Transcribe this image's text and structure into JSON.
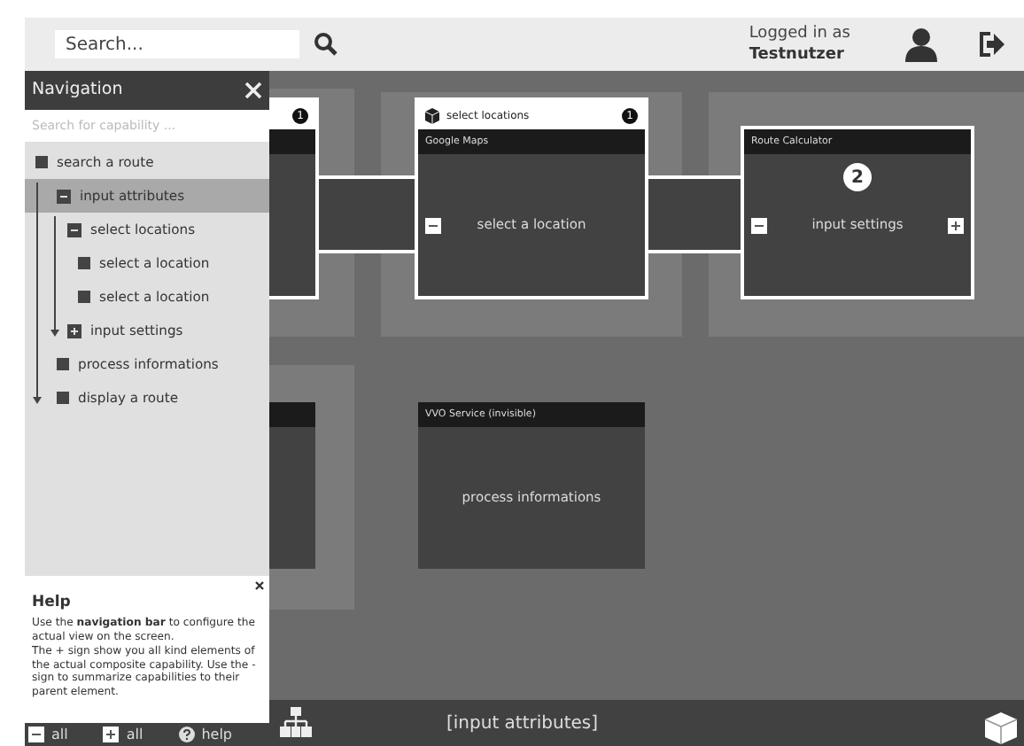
{
  "header": {
    "search_placeholder": "Search...",
    "login_label": "Logged in as",
    "username": "Testnutzer"
  },
  "navigation": {
    "title": "Navigation",
    "search_placeholder": "Search for capability ...",
    "tree": [
      {
        "label": "search a route",
        "selected": false,
        "children": [
          {
            "label": "input attributes",
            "selected": true,
            "expanded": true,
            "children": [
              {
                "label": "select locations",
                "selected": false,
                "expanded": true,
                "children": [
                  {
                    "label": "select a location",
                    "selected": false
                  },
                  {
                    "label": "select a location",
                    "selected": false
                  }
                ]
              },
              {
                "label": "input settings",
                "selected": false,
                "expanded": false
              }
            ]
          },
          {
            "label": "process informations",
            "selected": false
          },
          {
            "label": "display a route",
            "selected": false
          }
        ]
      }
    ]
  },
  "help": {
    "title": "Help",
    "text": "Use the **navigation bar** to configure the actual view on the screen.\nThe + sign show you all kind elements of the actual composite capability. Use the - sign to summarize capabilities to their parent element."
  },
  "canvas": {
    "nodes": [
      {
        "badge": "1",
        "outlined": true
      },
      {
        "caption": "select locations",
        "badge": "1",
        "service": "Google Maps",
        "label": "select a location",
        "minus": true,
        "plus": false,
        "outlined": true
      },
      {
        "service": "Route Calculator",
        "step": "2",
        "label": "input settings",
        "minus": true,
        "plus": true,
        "outlined": true
      },
      {
        "outlined": false
      },
      {
        "service": "VVO Service (invisible)",
        "label": "process informations",
        "minus": false,
        "plus": false,
        "outlined": false
      }
    ]
  },
  "footer": {
    "collapse_all": "all",
    "expand_all": "all",
    "help": "help",
    "breadcrumb": "[input attributes]"
  }
}
